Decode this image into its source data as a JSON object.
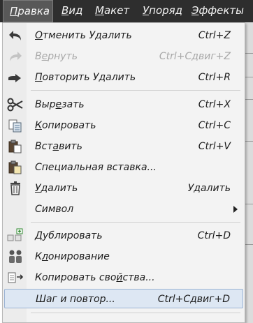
{
  "menubar": {
    "items": [
      {
        "label": "Правка",
        "underline": "П",
        "rest": "равка"
      },
      {
        "label": "Вид",
        "underline": "В",
        "rest": "ид"
      },
      {
        "label": "Макет",
        "underline": "М",
        "rest": "акет"
      },
      {
        "label": "Упоряд",
        "underline": "У",
        "rest": "поряд"
      },
      {
        "label": "Эффекты",
        "underline": "Э",
        "rest": "ффекты"
      }
    ]
  },
  "menu": {
    "undo": {
      "pre": "",
      "u": "О",
      "post": "тменить Удалить",
      "shortcut": "Ctrl+Z"
    },
    "redo": {
      "pre": "В",
      "u": "е",
      "post": "рнуть",
      "shortcut": "Ctrl+Сдвиг+Z"
    },
    "repeat": {
      "pre": "",
      "u": "П",
      "post": "овторить Удалить",
      "shortcut": "Ctrl+R"
    },
    "cut": {
      "pre": "Выр",
      "u": "е",
      "post": "зать",
      "shortcut": "Ctrl+X"
    },
    "copy": {
      "pre": "",
      "u": "К",
      "post": "опировать",
      "shortcut": "Ctrl+C"
    },
    "paste": {
      "pre": "Вст",
      "u": "а",
      "post": "вить",
      "shortcut": "Ctrl+V"
    },
    "paste_special": {
      "label": "Специальная вставка..."
    },
    "delete": {
      "pre": "",
      "u": "У",
      "post": "далить",
      "shortcut": "Удалить"
    },
    "symbol": {
      "label": "Символ"
    },
    "duplicate": {
      "pre": "",
      "u": "Д",
      "post": "ублировать",
      "shortcut": "Ctrl+D"
    },
    "clone": {
      "pre": "К",
      "u": "л",
      "post": "онирование"
    },
    "copy_props": {
      "pre": "Копировать сво",
      "u": "й",
      "post": "ства..."
    },
    "step_repeat": {
      "label": "Шаг и повтор...",
      "shortcut": "Ctrl+Сдвиг+D"
    }
  }
}
